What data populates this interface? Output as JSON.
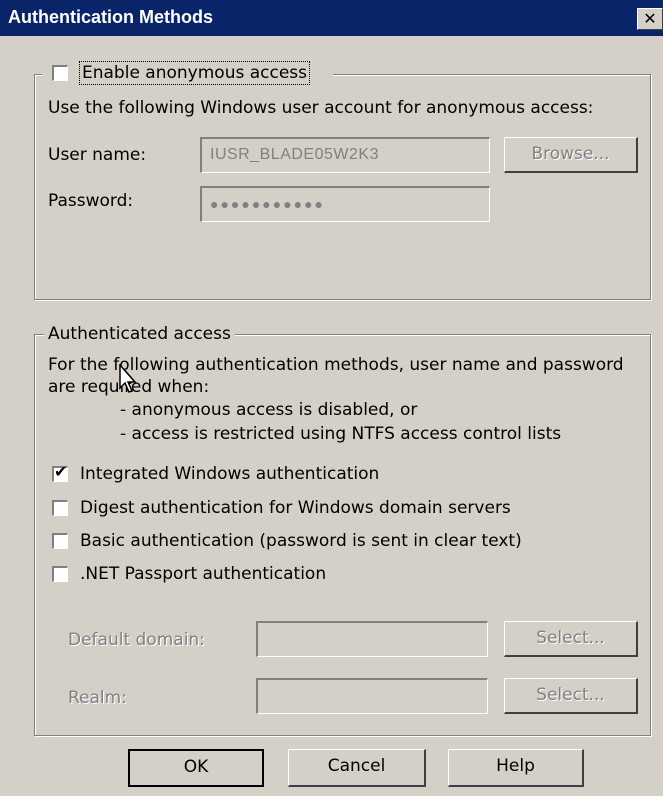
{
  "window": {
    "title": "Authentication Methods"
  },
  "anonymous": {
    "checkbox_label": "Enable anonymous access",
    "checked": false,
    "description": "Use the following Windows user account for anonymous access:",
    "username_label": "User name:",
    "username_value": "IUSR_BLADE05W2K3",
    "browse_label": "Browse...",
    "password_label": "Password:",
    "password_value": "●●●●●●●●●●●"
  },
  "authenticated": {
    "group_label": "Authenticated access",
    "description_line1": "For the following authentication methods, user name and password",
    "description_line2": "are required when:",
    "bullet1": "- anonymous access is disabled, or",
    "bullet2": "- access is restricted using NTFS access control lists",
    "options": [
      {
        "label": "Integrated Windows authentication",
        "checked": true
      },
      {
        "label": "Digest authentication for Windows domain servers",
        "checked": false
      },
      {
        "label": "Basic authentication (password is sent in clear text)",
        "checked": false
      },
      {
        "label": ".NET Passport authentication",
        "checked": false
      }
    ],
    "default_domain_label": "Default domain:",
    "realm_label": "Realm:",
    "select_label": "Select..."
  },
  "buttons": {
    "ok": "OK",
    "cancel": "Cancel",
    "help": "Help"
  },
  "colors": {
    "titlebar": "#0a246a",
    "face": "#d4d0c8",
    "disabled_text": "#808080"
  }
}
